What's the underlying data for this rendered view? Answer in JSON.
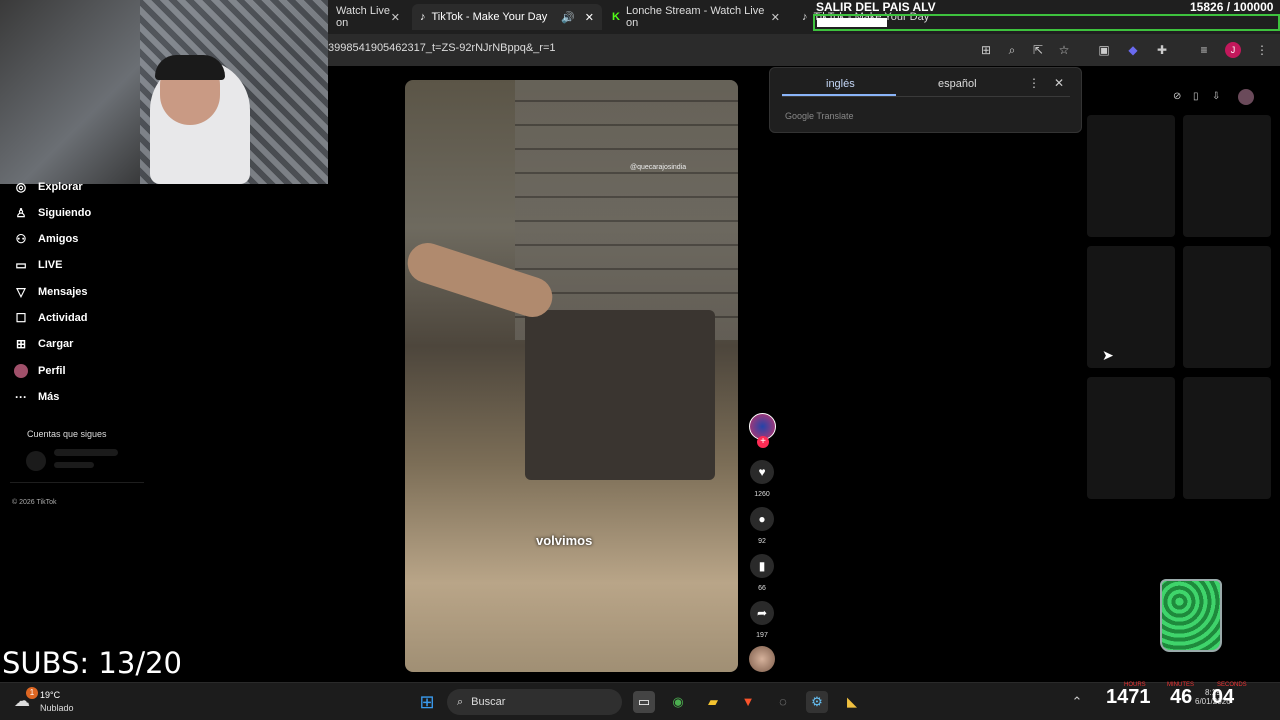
{
  "browser": {
    "tabs": [
      {
        "label": "Watch Live on",
        "active": false
      },
      {
        "label": "TikTok - Make Your Day",
        "active": true
      },
      {
        "label": "Lonche Stream - Watch Live on",
        "active": false
      },
      {
        "label": "TikTok - Make Your Day",
        "active": false
      }
    ],
    "url": "3998541905462317_t=ZS-92rNJrNBppq&_r=1"
  },
  "sidebar": {
    "items": [
      {
        "label": "Explorar",
        "icon": "compass-icon"
      },
      {
        "label": "Siguiendo",
        "icon": "person-icon"
      },
      {
        "label": "Amigos",
        "icon": "friends-icon"
      },
      {
        "label": "LIVE",
        "icon": "live-icon"
      },
      {
        "label": "Mensajes",
        "icon": "paper-plane-icon"
      },
      {
        "label": "Actividad",
        "icon": "inbox-icon"
      },
      {
        "label": "Cargar",
        "icon": "upload-icon"
      },
      {
        "label": "Perfil",
        "icon": "avatar-icon"
      },
      {
        "label": "Más",
        "icon": "more-icon"
      }
    ],
    "following_title": "Cuentas que sigues",
    "copyright": "© 2026 TikTok"
  },
  "video": {
    "watermark": "@quecarajosindia",
    "caption": "volvimos",
    "likes": "1260",
    "comments": "92",
    "saves": "66",
    "shares": "197"
  },
  "translate": {
    "lang_from": "inglés",
    "lang_to": "español",
    "provider": "Google Translate"
  },
  "overlay": {
    "stream_title": "SALIR DEL PAIS ALV",
    "goal": "15826 / 100000",
    "subs": "SUBS: 13/20",
    "timer_hours": "1471",
    "timer_minutes": "46",
    "timer_seconds": "04",
    "label_hours": "HOURS",
    "label_minutes": "MINUTES",
    "label_seconds": "SECONDS"
  },
  "taskbar": {
    "weather_temp": "19°C",
    "weather_desc": "Nublado",
    "weather_badge": "1",
    "search_placeholder": "Buscar",
    "time": "8:19",
    "date": "6/01/2026"
  },
  "colors": {
    "accent_red": "#fe2c55",
    "goal_green": "#3ec23e",
    "translate_blue": "#8ab4f8"
  }
}
